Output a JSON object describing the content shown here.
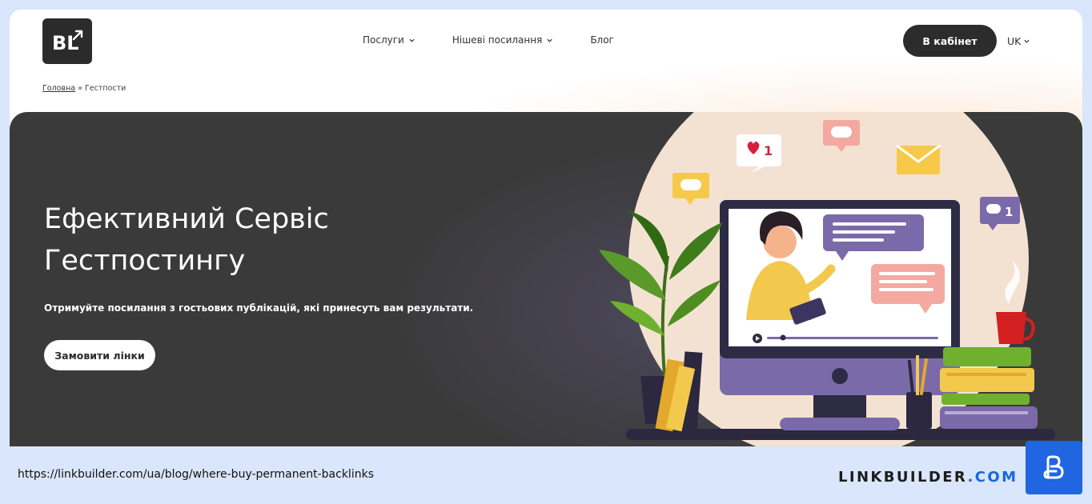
{
  "header": {
    "logo_text": "BL",
    "nav": [
      {
        "label": "Послуги",
        "has_dropdown": true
      },
      {
        "label": "Нішеві посилання",
        "has_dropdown": true
      },
      {
        "label": "Блог",
        "has_dropdown": false
      }
    ],
    "cabinet_label": "В кабінет",
    "language": "UK"
  },
  "breadcrumb": {
    "home": "Головна",
    "separator": " » ",
    "current": "Гестпости"
  },
  "hero": {
    "title": "Ефективний Сервіс Гестпостингу",
    "subtitle": "Отримуйте посилання з гостьових публікацій, які принесуть вам результати.",
    "cta_label": "Замовити лінки",
    "illustration": {
      "likes_count": "1",
      "comments_count": "1"
    }
  },
  "footer": {
    "url": "https://linkbuilder.com/ua/blog/where-buy-permanent-backlinks",
    "brand_name": "LINKBUILDER",
    "brand_dot": ".",
    "brand_tld": "COM"
  },
  "colors": {
    "hero_bg": "#3a3a3a",
    "dark_button": "#2c2c2c",
    "brand_blue": "#1f66e0",
    "footer_bg": "#d9e6fb",
    "accent_purple": "#7b6aa9"
  }
}
